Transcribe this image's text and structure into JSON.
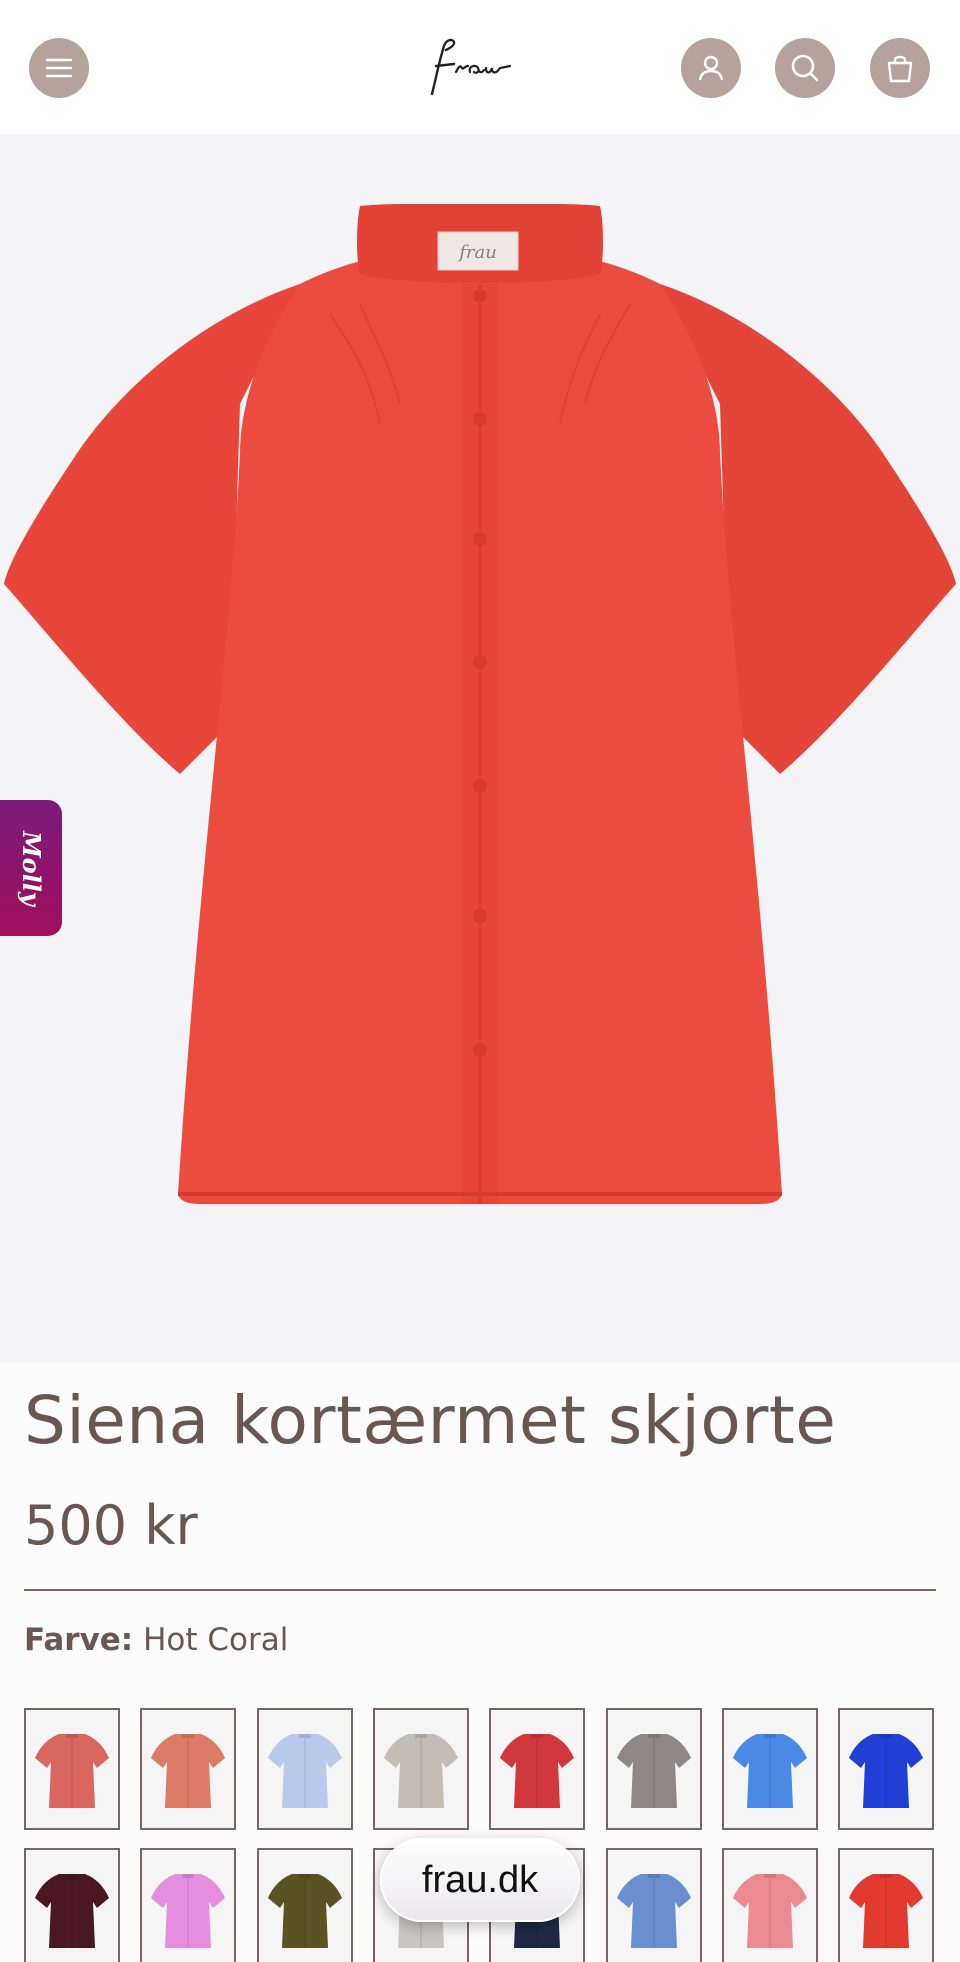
{
  "header": {
    "logo_text": "frau",
    "icons": [
      "menu-icon",
      "account-icon",
      "search-icon",
      "bag-icon"
    ],
    "button_color": "#b5a39b"
  },
  "product": {
    "image_alt": "Siena kortærmet skjorte i Hot Coral",
    "shirt_color": "#e8483c",
    "label_text": "frau",
    "title": "Siena kortærmet skjorte",
    "price": "500 kr",
    "color_label": "Farve:",
    "color_value": "Hot Coral"
  },
  "molly_tab": {
    "label": "Molly"
  },
  "swatches": [
    {
      "color": "#d9675f"
    },
    {
      "color": "#dc7b66"
    },
    {
      "color": "#b9c9ec"
    },
    {
      "color": "#c4bdb5"
    },
    {
      "color": "#d1383e"
    },
    {
      "color": "#8e8786"
    },
    {
      "color": "#4a8ae6"
    },
    {
      "color": "#1f3fd6"
    },
    {
      "color": "#4a1820"
    },
    {
      "color": "#e58ede"
    },
    {
      "color": "#5c5322"
    },
    {
      "color": "#c9c5c0"
    },
    {
      "color": "#1e2a44"
    },
    {
      "color": "#6a8fd0"
    },
    {
      "color": "#eb8a93"
    },
    {
      "color": "#e33a2f"
    }
  ],
  "browser_pill": {
    "label": "frau.dk"
  }
}
